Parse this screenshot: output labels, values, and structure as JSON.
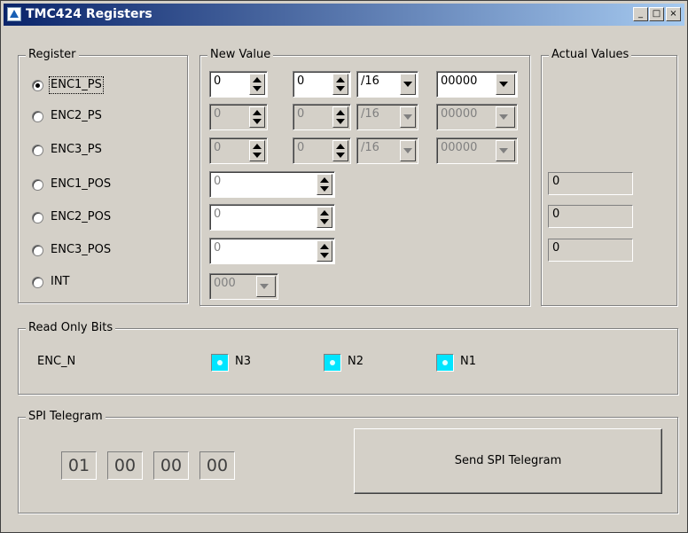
{
  "window": {
    "title": "TMC424 Registers"
  },
  "groups": {
    "register": "Register",
    "new_value": "New Value",
    "actual_values": "Actual Values",
    "read_only_bits": "Read Only Bits",
    "spi_telegram": "SPI Telegram"
  },
  "registers": [
    {
      "label": "ENC1_PS",
      "selected": true
    },
    {
      "label": "ENC2_PS",
      "selected": false
    },
    {
      "label": "ENC3_PS",
      "selected": false
    },
    {
      "label": "ENC1_POS",
      "selected": false
    },
    {
      "label": "ENC2_POS",
      "selected": false
    },
    {
      "label": "ENC3_POS",
      "selected": false
    },
    {
      "label": "INT",
      "selected": false
    }
  ],
  "new_value": {
    "ps_rows": [
      {
        "a": "0",
        "b": "0",
        "div": "/16",
        "code": "00000",
        "enabled": true
      },
      {
        "a": "0",
        "b": "0",
        "div": "/16",
        "code": "00000",
        "enabled": false
      },
      {
        "a": "0",
        "b": "0",
        "div": "/16",
        "code": "00000",
        "enabled": false
      }
    ],
    "pos_rows": [
      {
        "value": "0"
      },
      {
        "value": "0"
      },
      {
        "value": "0"
      }
    ],
    "int_select": "000"
  },
  "actual_values": [
    "0",
    "0",
    "0"
  ],
  "read_only_bits": {
    "label": "ENC_N",
    "bits": [
      {
        "name": "N3",
        "color": "#00e5ff"
      },
      {
        "name": "N2",
        "color": "#00e5ff"
      },
      {
        "name": "N1",
        "color": "#00e5ff"
      }
    ]
  },
  "spi_telegram": {
    "bytes": [
      "01",
      "00",
      "00",
      "00"
    ],
    "send_label": "Send SPI Telegram"
  }
}
